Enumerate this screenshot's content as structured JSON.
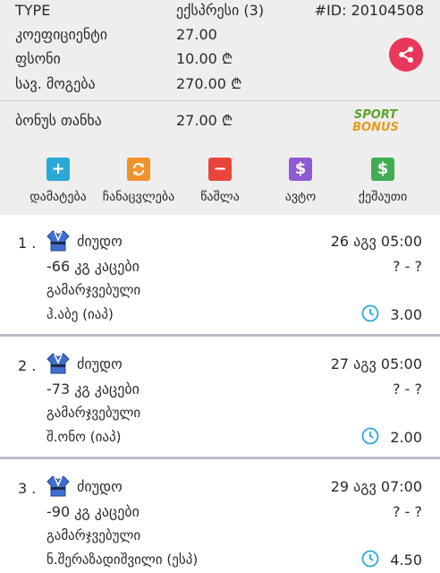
{
  "summary": {
    "type_label": "TYPE",
    "type_value": "ექსპრესი (3)",
    "id_text": "#ID: 20104508",
    "coef_label": "კოეფიციენტი",
    "coef_value": "27.00",
    "price_label": "ფსონი",
    "price_value": "10.00 ₾",
    "win_label": "სავ. მოგება",
    "win_value": "270.00 ₾",
    "bonus_label": "ბონუს თანხა",
    "bonus_value": "27.00 ₾",
    "logo_line1": "SPORT",
    "logo_line2": "BONUS"
  },
  "actions": [
    {
      "label": "დამატება",
      "icon": "plus-icon",
      "color": "#29a9d6"
    },
    {
      "label": "ჩანაცვლება",
      "icon": "swap-icon",
      "color": "#f0932b"
    },
    {
      "label": "წაშლა",
      "icon": "minus-icon",
      "color": "#e8463c"
    },
    {
      "label": "ავტო",
      "icon": "dollar-icon",
      "color": "#8e5ad4"
    },
    {
      "label": "ქეშაუთი",
      "icon": "dollar-icon",
      "color": "#3fae50"
    }
  ],
  "bets": [
    {
      "num": "1 .",
      "sport": "ძიუდო",
      "date": "26 აგვ 05:00",
      "market": "-66 კგ კაცები",
      "score": "? - ?",
      "pick": "გამარჯვებული",
      "team": "ჰ.აბე (იაპ)",
      "odd": "3.00"
    },
    {
      "num": "2 .",
      "sport": "ძიუდო",
      "date": "27 აგვ 05:00",
      "market": "-73 კგ კაცები",
      "score": "? - ?",
      "pick": "გამარჯვებული",
      "team": "შ.ონო (იაპ)",
      "odd": "2.00"
    },
    {
      "num": "3 .",
      "sport": "ძიუდო",
      "date": "29 აგვ 07:00",
      "market": "-90 კგ კაცები",
      "score": "? - ?",
      "pick": "გამარჯვებული",
      "team": "ნ.შერაზადიშვილი (ესპ)",
      "odd": "4.50"
    }
  ],
  "colors": {
    "share": "#e8385a",
    "clock": "#29a9d6",
    "separator": "#bcbcc8"
  }
}
